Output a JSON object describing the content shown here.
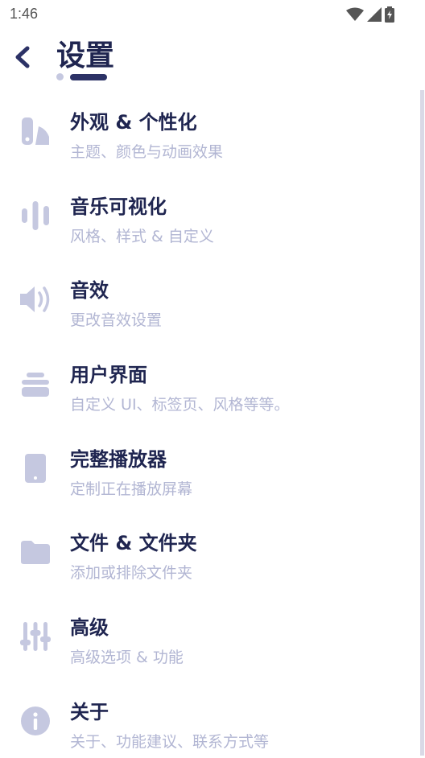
{
  "status_bar": {
    "time": "1:46"
  },
  "header": {
    "title": "设置"
  },
  "items": [
    {
      "label": "外观 & 个性化",
      "sub": "主题、颜色与动画效果",
      "icon": "palette-icon"
    },
    {
      "label": "音乐可视化",
      "sub": "风格、样式 & 自定义",
      "icon": "equalizer-bars-icon"
    },
    {
      "label": "音效",
      "sub": "更改音效设置",
      "icon": "speaker-icon"
    },
    {
      "label": "用户界面",
      "sub": "自定义 UI、标签页、风格等等。",
      "icon": "layers-icon"
    },
    {
      "label": "完整播放器",
      "sub": "定制正在播放屏幕",
      "icon": "phone-icon"
    },
    {
      "label": "文件 & 文件夹",
      "sub": "添加或排除文件夹",
      "icon": "folder-icon"
    },
    {
      "label": "高级",
      "sub": "高级选项 & 功能",
      "icon": "sliders-icon"
    },
    {
      "label": "关于",
      "sub": "关于、功能建议、联系方式等",
      "icon": "info-icon"
    }
  ],
  "colors": {
    "accent": "#2c3266",
    "icon_muted": "#c5c8e0",
    "subtext": "#b2b6d3"
  }
}
